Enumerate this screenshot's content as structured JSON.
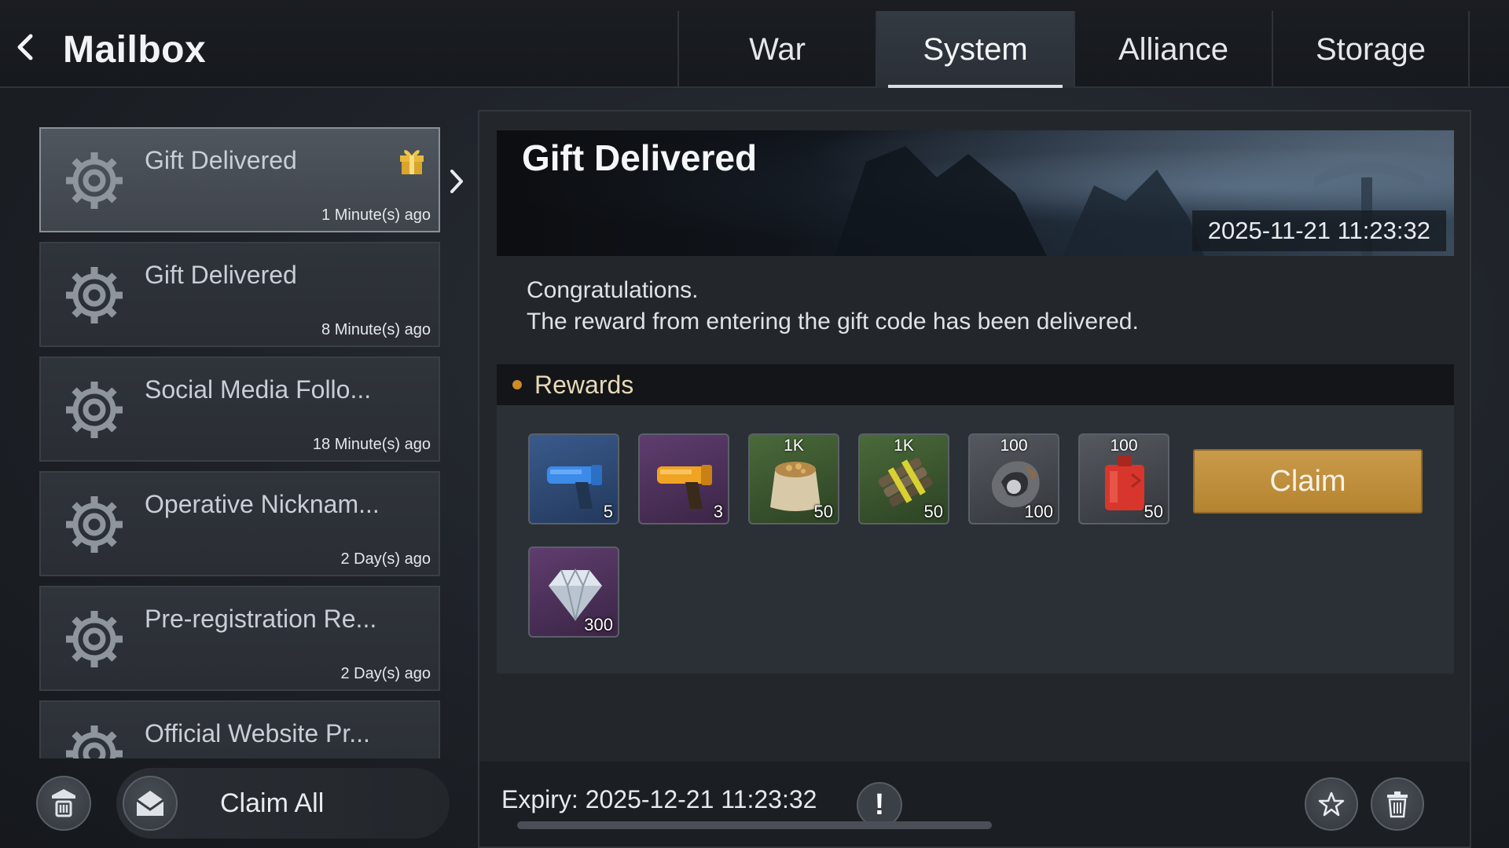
{
  "header": {
    "back_icon": "chevron-left-icon",
    "title": "Mailbox",
    "tabs": [
      {
        "label": "War",
        "active": false
      },
      {
        "label": "System",
        "active": true
      },
      {
        "label": "Alliance",
        "active": false
      },
      {
        "label": "Storage",
        "active": false
      }
    ]
  },
  "mail_list": {
    "items": [
      {
        "title": "Gift Delivered",
        "time": "1 Minute(s) ago",
        "icon": "gear-icon",
        "has_gift": true,
        "selected": true
      },
      {
        "title": "Gift Delivered",
        "time": "8 Minute(s) ago",
        "icon": "gear-icon",
        "has_gift": false,
        "selected": false
      },
      {
        "title": "Social Media Follo...",
        "time": "18 Minute(s) ago",
        "icon": "gear-icon",
        "has_gift": false,
        "selected": false
      },
      {
        "title": "Operative Nicknam...",
        "time": "2 Day(s) ago",
        "icon": "gear-icon",
        "has_gift": false,
        "selected": false
      },
      {
        "title": "Pre-registration Re...",
        "time": "2 Day(s) ago",
        "icon": "gear-icon",
        "has_gift": false,
        "selected": false
      },
      {
        "title": "Official Website Pr...",
        "time": "",
        "icon": "gear-icon",
        "has_gift": false,
        "selected": false
      }
    ]
  },
  "left_footer": {
    "delete_read_icon": "delete-mail-icon",
    "claim_all_icon": "open-envelope-icon",
    "claim_all_label": "Claim All"
  },
  "detail": {
    "title": "Gift Delivered",
    "timestamp": "2025-11-21 11:23:32",
    "message_line1": "Congratulations.",
    "message_line2": "The reward from entering the gift code has been delivered.",
    "rewards_title": "Rewards",
    "rewards": [
      {
        "name": "blue-flare-gun-icon",
        "top_label": "",
        "quantity": "5",
        "color": "#3a5a8c"
      },
      {
        "name": "orange-flare-gun-icon",
        "top_label": "",
        "quantity": "3",
        "color": "#5f3d6e"
      },
      {
        "name": "food-sack-icon",
        "top_label": "1K",
        "quantity": "50",
        "color": "#4a6a3a"
      },
      {
        "name": "wood-bundle-icon",
        "top_label": "1K",
        "quantity": "50",
        "color": "#4a6a3a"
      },
      {
        "name": "steel-ore-icon",
        "top_label": "100",
        "quantity": "100",
        "color": "#55595f"
      },
      {
        "name": "fuel-can-icon",
        "top_label": "100",
        "quantity": "50",
        "color": "#55595f"
      },
      {
        "name": "diamond-icon",
        "top_label": "",
        "quantity": "300",
        "color": "#5f3d6e"
      }
    ],
    "claim_label": "Claim",
    "expiry": "Expiry: 2025-12-21 11:23:32",
    "warning_glyph": "!",
    "favorite_icon": "star-icon",
    "delete_icon": "trash-icon"
  },
  "colors": {
    "accent_gold": "#c99a4a",
    "rewards_dot": "#d08a28",
    "panel_bg": "#23272c"
  }
}
